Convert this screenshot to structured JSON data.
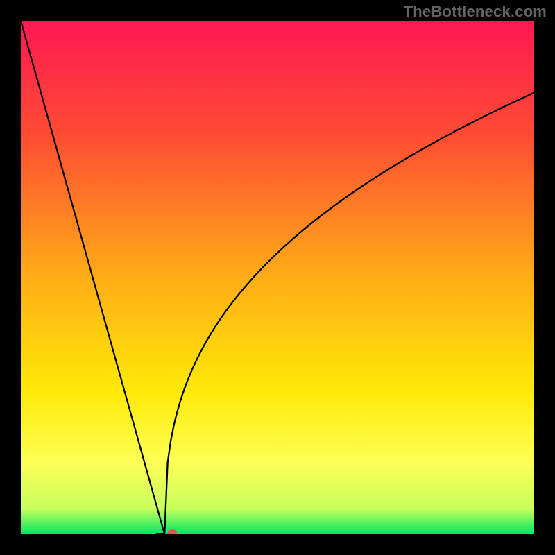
{
  "watermark": "TheBottleneck.com",
  "chart_data": {
    "type": "line",
    "title": "",
    "xlabel": "",
    "ylabel": "",
    "xlim": [
      0,
      100
    ],
    "ylim": [
      0,
      100
    ],
    "grid": false,
    "legend": false,
    "background_gradient": {
      "stops": [
        {
          "pct": 0,
          "color": "#ff1852"
        },
        {
          "pct": 22,
          "color": "#ff4b33"
        },
        {
          "pct": 50,
          "color": "#ffad17"
        },
        {
          "pct": 72,
          "color": "#ffe907"
        },
        {
          "pct": 86,
          "color": "#fdff55"
        },
        {
          "pct": 95,
          "color": "#c8ff5c"
        },
        {
          "pct": 100,
          "color": "#00e763"
        }
      ]
    },
    "curve": {
      "description": "V-shaped bottleneck curve: steep linear descent from top-left to a minimum, then log-like ascent toward upper-right",
      "minimum_x": 28,
      "series": [
        {
          "name": "left-branch",
          "x": [
            0,
            28
          ],
          "y": [
            100,
            0
          ],
          "form": "linear"
        },
        {
          "name": "right-branch",
          "x": [
            28,
            100
          ],
          "y": [
            0,
            86
          ],
          "form": "concave-sqrt-like"
        }
      ]
    },
    "marker": {
      "x": 29.5,
      "y": 0,
      "radius_px": 7,
      "color": "#d65a4f"
    }
  }
}
